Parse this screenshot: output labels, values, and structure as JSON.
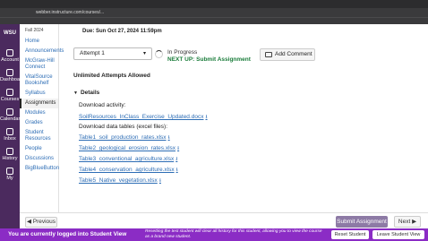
{
  "browser": {
    "url": "webber.instructure.com/courses/..."
  },
  "global_nav": {
    "logo": "WSU",
    "items": [
      {
        "label": "Account"
      },
      {
        "label": "Dashboard"
      },
      {
        "label": "Courses"
      },
      {
        "label": "Calendar"
      },
      {
        "label": "Inbox"
      },
      {
        "label": "History"
      },
      {
        "label": "My"
      }
    ]
  },
  "course_nav": {
    "term": "Fall 2024",
    "items": [
      {
        "label": "Home",
        "active": false
      },
      {
        "label": "Announcements",
        "active": false
      },
      {
        "label": "McGraw-Hill Connect",
        "active": false
      },
      {
        "label": "VitalSource Bookshelf",
        "active": false
      },
      {
        "label": "Syllabus",
        "active": false
      },
      {
        "label": "Assignments",
        "active": true
      },
      {
        "label": "Modules",
        "active": false
      },
      {
        "label": "Grades",
        "active": false
      },
      {
        "label": "Student Resources",
        "active": false
      },
      {
        "label": "People",
        "active": false
      },
      {
        "label": "Discussions",
        "active": false
      },
      {
        "label": "BigBlueButton",
        "active": false
      }
    ]
  },
  "main": {
    "due": "Due: Sun Oct 27, 2024 11:59pm",
    "attempt_select": "Attempt 1",
    "status": "In Progress",
    "next_up": "NEXT UP: Submit Assignment",
    "add_comment": "Add Comment",
    "unlimited": "Unlimited Attempts Allowed",
    "details_label": "Details",
    "download_activity_label": "Download activity:",
    "activity_file": "SoilResources_InClass_Exercise_Updated.docx",
    "download_tables_label": "Download data tables (excel files):",
    "files": [
      "Table1_soil_production_rates.xlsx",
      "Table2_geological_erosion_rates.xlsx",
      "Table3_conventional_agriculture.xlsx",
      "Table4_conservation_agriculture.xlsx",
      "Table5_Native_vegetation.xlsx"
    ]
  },
  "footer": {
    "previous": "Previous",
    "submit": "Submit Assignment",
    "next": "Next"
  },
  "student_view": {
    "message": "You are currently logged into Student View",
    "note": "Resetting the test student will clear all history for this student, allowing you to view the course as a brand new student.",
    "reset": "Reset Student",
    "leave": "Leave Student View"
  }
}
